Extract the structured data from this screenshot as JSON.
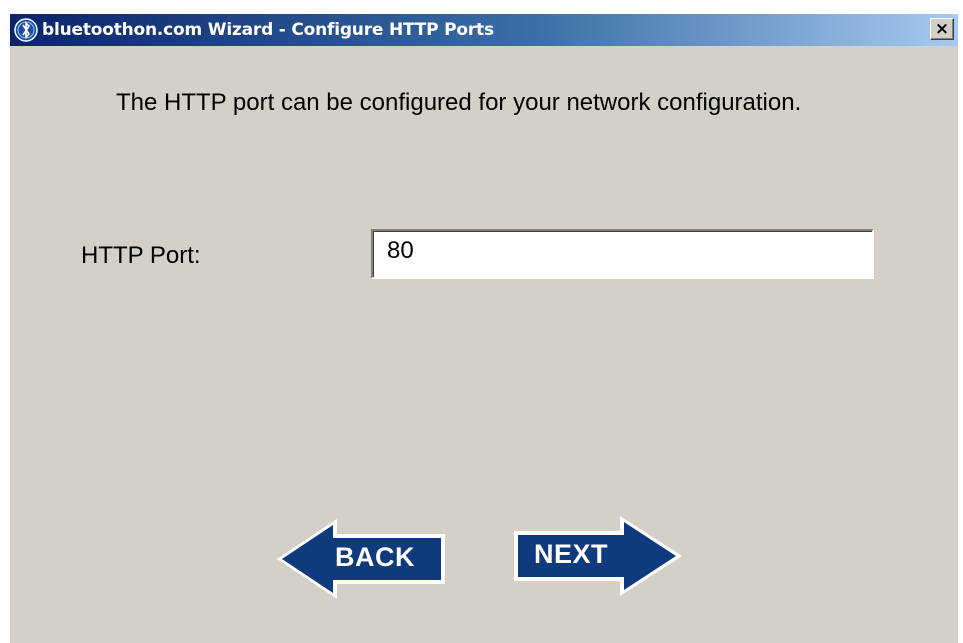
{
  "window": {
    "title": "bluetoothon.com Wizard - Configure HTTP Ports",
    "close_glyph": "×",
    "app_icon": "bluetooth-globe-icon"
  },
  "content": {
    "instruction": "The HTTP port can be configured for your network configuration.",
    "port_label": "HTTP Port:",
    "port_value": "80"
  },
  "nav": {
    "back_label": "BACK",
    "next_label": "NEXT"
  },
  "colors": {
    "button_fill": "#0f3a7d",
    "dialog_bg": "#d4d0c8"
  }
}
